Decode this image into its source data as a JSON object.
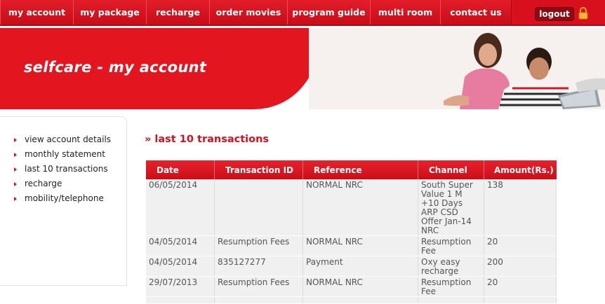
{
  "nav": {
    "items": [
      "my account",
      "my package",
      "recharge",
      "order movies",
      "program guide",
      "multi room",
      "contact us"
    ],
    "logout_label": "logout"
  },
  "banner": {
    "title": "selfcare - my account"
  },
  "sidebar": {
    "items": [
      "view account details",
      "monthly statement",
      "last 10 transactions",
      "recharge",
      "mobility/telephone"
    ]
  },
  "main": {
    "section_title": "» last 10 transactions",
    "table": {
      "headers": [
        "Date",
        "Transaction ID",
        "Reference",
        "Channel",
        "Amount(Rs.)"
      ],
      "rows": [
        [
          "06/05/2014",
          "",
          "NORMAL NRC",
          "South Super Value 1 M +10 Days ARP CSD Offer Jan-14 NRC",
          "138"
        ],
        [
          "04/05/2014",
          "Resumption Fees",
          "NORMAL NRC",
          "Resumption Fee",
          "20"
        ],
        [
          "04/05/2014",
          "835127277",
          "Payment",
          "Oxy easy recharge",
          "200"
        ],
        [
          "29/07/2013",
          "Resumption Fees",
          "NORMAL NRC",
          "Resumption Fee",
          "20"
        ],
        [
          "",
          "",
          "",
          "",
          ""
        ]
      ]
    }
  },
  "colors": {
    "brand_red": "#d8101e",
    "table_row_bg": "#f0f0f0"
  }
}
